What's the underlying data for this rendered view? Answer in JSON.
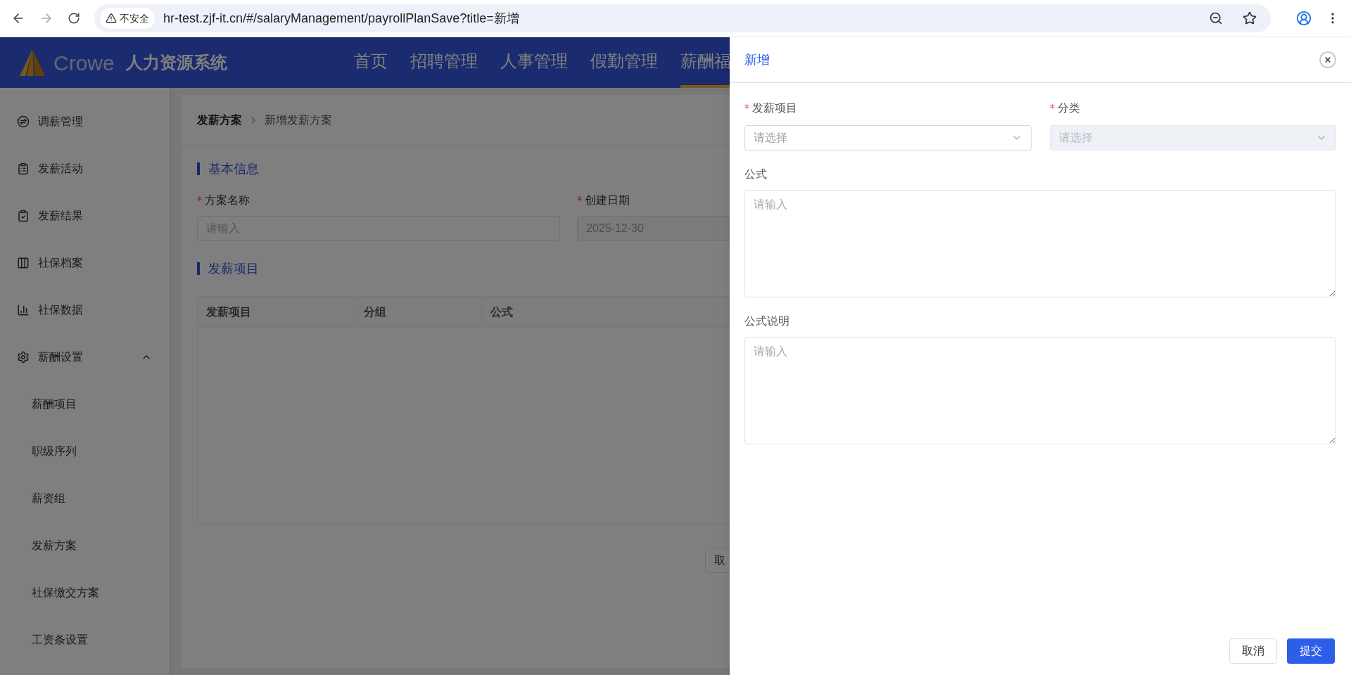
{
  "browser": {
    "security": "不安全",
    "url": "hr-test.zjf-it.cn/#/salaryManagement/payrollPlanSave?title=新增"
  },
  "header": {
    "brand": "Crowe",
    "system": "人力资源系统",
    "nav": [
      {
        "label": "首页",
        "selected": false
      },
      {
        "label": "招聘管理",
        "selected": false
      },
      {
        "label": "人事管理",
        "selected": false
      },
      {
        "label": "假勤管理",
        "selected": false
      },
      {
        "label": "薪酬福",
        "selected": true
      }
    ]
  },
  "sidebar": {
    "items": [
      {
        "label": "调薪管理"
      },
      {
        "label": "发薪活动"
      },
      {
        "label": "发薪结果"
      },
      {
        "label": "社保档案"
      },
      {
        "label": "社保数据"
      },
      {
        "label": "薪酬设置",
        "expanded": true,
        "children": [
          {
            "label": "薪酬项目"
          },
          {
            "label": "职级序列"
          },
          {
            "label": "薪资组"
          },
          {
            "label": "发薪方案"
          },
          {
            "label": "社保缴交方案"
          },
          {
            "label": "工资条设置"
          }
        ]
      }
    ]
  },
  "breadcrumb": [
    "发薪方案",
    "新增发薪方案"
  ],
  "basic_section": {
    "title": "基本信息",
    "fields": [
      {
        "label": "方案名称",
        "required": true,
        "placeholder": "请输入",
        "disabled": false
      },
      {
        "label": "创建日期",
        "required": true,
        "value": "2025-12-30",
        "disabled": true
      }
    ]
  },
  "items_section": {
    "title": "发薪项目",
    "columns": [
      "发薪项目",
      "分组",
      "公式"
    ]
  },
  "page_button": "取",
  "drawer": {
    "title": "新增",
    "selects": [
      {
        "label": "发薪项目",
        "required": true,
        "placeholder": "请选择",
        "disabled": false
      },
      {
        "label": "分类",
        "required": true,
        "placeholder": "请选择",
        "disabled": true
      }
    ],
    "textareas": [
      {
        "label": "公式",
        "placeholder": "请输入"
      },
      {
        "label": "公式说明",
        "placeholder": "请输入"
      }
    ],
    "buttons": [
      {
        "label": "取消",
        "kind": "default"
      },
      {
        "label": "提交",
        "kind": "primary"
      }
    ]
  }
}
